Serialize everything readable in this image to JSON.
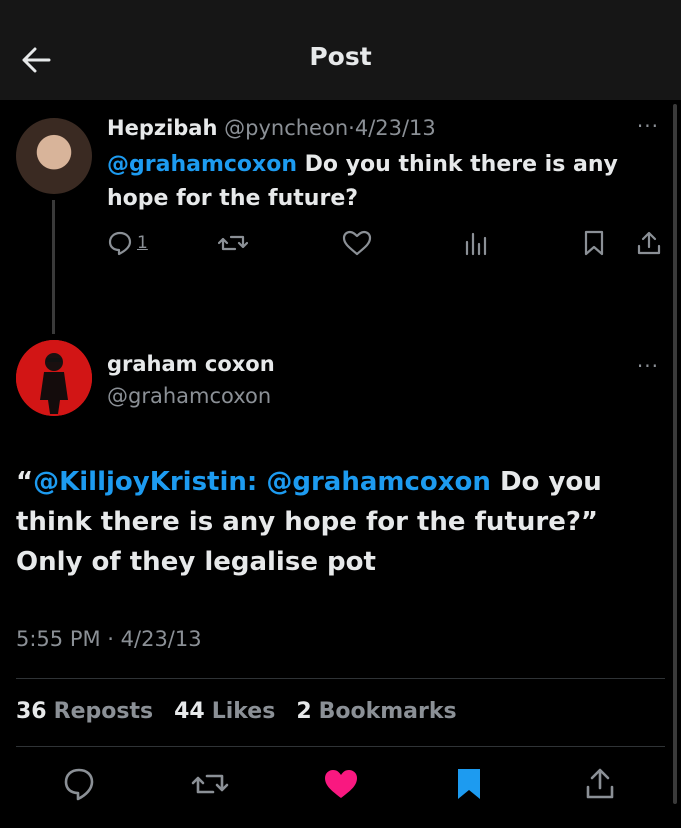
{
  "header": {
    "title": "Post",
    "back_icon": "arrow-left-icon"
  },
  "reply": {
    "name": "Hepzibah",
    "handle": "@pyncheon",
    "separator": "·",
    "date": "4/23/13",
    "mention": "@grahamcoxon",
    "text": " Do you think there is any hope for the future?",
    "reply_count": "1"
  },
  "main": {
    "name": "graham coxon",
    "handle": "@grahamcoxon",
    "text_open": "“",
    "mention1": "@KilljoyKristin:",
    "space": " ",
    "mention2": "@grahamcoxon",
    "text_rest": " Do you think there is any hope for the future?” Only of they legalise pot",
    "timestamp": "5:55 PM · 4/23/13"
  },
  "stats": {
    "reposts_count": "36",
    "reposts_label": "Reposts",
    "likes_count": "44",
    "likes_label": "Likes",
    "bookmarks_count": "2",
    "bookmarks_label": "Bookmarks"
  },
  "more_glyph": "···",
  "colors": {
    "accent": "#1d9bf0",
    "like": "#f91880",
    "muted": "#8b9096"
  }
}
